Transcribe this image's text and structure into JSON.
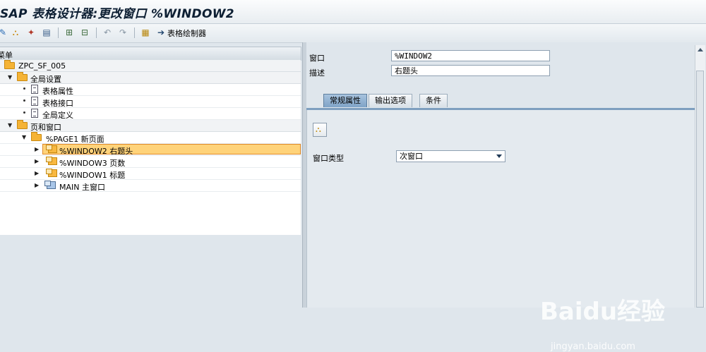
{
  "window": {
    "title": "SAP 表格设计器:更改窗口 %WINDOW2"
  },
  "toolbar": {
    "form_painter_label": "表格绘制器"
  },
  "tree": {
    "header": "菜单",
    "root": "ZPC_SF_005",
    "rows": [
      {
        "label": "全局设置"
      },
      {
        "label": "表格属性"
      },
      {
        "label": "表格接口"
      },
      {
        "label": "全局定义"
      },
      {
        "label": "页和窗口"
      },
      {
        "label": "%PAGE1 新页面"
      },
      {
        "label": "%WINDOW2 右题头"
      },
      {
        "label": "%WINDOW3 页数"
      },
      {
        "label": "%WINDOW1 标题"
      },
      {
        "label": "MAIN 主窗口"
      }
    ]
  },
  "form": {
    "window_label": "窗口",
    "window_value": "%WINDOW2",
    "desc_label": "描述",
    "desc_value": "右题头",
    "tabs": [
      "常规属性",
      "输出选项",
      "条件"
    ],
    "active_tab": "常规属性",
    "window_type_label": "窗口类型",
    "window_type_value": "次窗口"
  },
  "watermark": {
    "main": "Baidu经验",
    "sub": "jingyan.baidu.com"
  },
  "colors": {
    "selection": "#ffd37a",
    "selection_border": "#e08a2a",
    "active_tab": "#8fb0d3"
  }
}
